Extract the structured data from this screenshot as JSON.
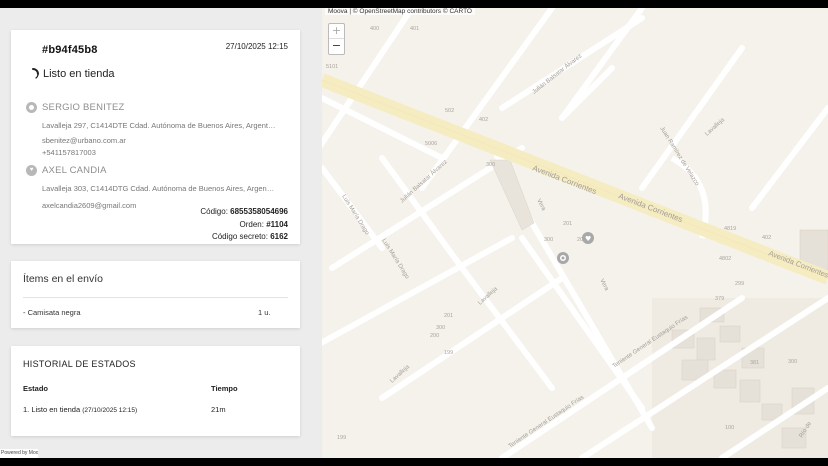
{
  "order": {
    "id": "#b94f45b8",
    "datetime": "27/10/2025 12:15",
    "status": "Listo en tienda"
  },
  "sender": {
    "name": "SERGIO BENITEZ",
    "address": "Lavalleja 297, C1414DTE Cdad. Autónoma de Buenos Aires, Argentina",
    "email": "sbenitez@urbano.com.ar",
    "phone": "+541157817003"
  },
  "recipient": {
    "name": "AXEL CANDIA",
    "address": "Lavalleja 303, C1414DTG Cdad. Autónoma de Buenos Aires, Argentina",
    "email": "axelcandia2609@gmail.com"
  },
  "codes": {
    "codigo_label": "Código:",
    "codigo": "6855358054696",
    "orden_label": "Orden:",
    "orden": "#1104",
    "secreto_label": "Código secreto:",
    "secreto": "6162"
  },
  "items": {
    "title": "Ítems en el envío",
    "list": [
      {
        "name": "- Camisata negra",
        "qty": "1 u."
      }
    ]
  },
  "history": {
    "title": "HISTORIAL DE ESTADOS",
    "col_estado": "Estado",
    "col_tiempo": "Tiempo",
    "rows": [
      {
        "estado": "1. Listo en tienda",
        "fecha": "(27/10/2025 12:15)",
        "tiempo": "21m"
      }
    ]
  },
  "footer": {
    "powered": "Powered by Moova"
  },
  "map": {
    "attribution": "Moova | © OpenStreetMap contributors © CARTO",
    "zoom_in": "+",
    "zoom_out": "−",
    "streets": {
      "corrientes_1": "Avenida Corrientes",
      "corrientes_2": "Avenida Corrientes",
      "corrientes_3": "Avenida Corrientes",
      "balsatar_1": "Julián Balsatar Álvarez",
      "balsatar_2": "Julián Balsatar Álvarez",
      "vera_1": "Vera",
      "vera_2": "Vera",
      "luis_drago_1": "Luis María Drago",
      "luis_drago_2": "Luis María Drago",
      "lavalleja_1": "Lavalleja",
      "lavalleja_2": "Lavalleja",
      "lavalleja_3": "Lavalleja",
      "frias_1": "Teniente General Eustaquio Frías",
      "frias_2": "Teniente General Eustaquio Frías",
      "velazco": "Juan Ramírez de Velazco",
      "rio_de": "Río de"
    },
    "numbers": [
      "401",
      "400",
      "5101",
      "502",
      "402",
      "5006",
      "300",
      "201",
      "200",
      "300",
      "4819",
      "402",
      "4802",
      "300",
      "201",
      "200",
      "199",
      "299",
      "379",
      "381",
      "100",
      "199",
      "300"
    ]
  },
  "colors": {
    "map_bg": "#f5f2ec",
    "avenue": "#f6ecc2",
    "street": "#ffffff",
    "panel_bg": "#ececec"
  }
}
